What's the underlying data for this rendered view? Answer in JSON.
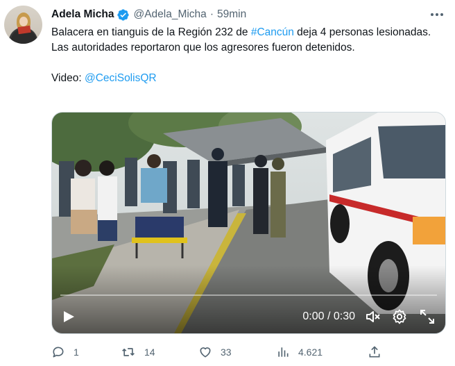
{
  "author": {
    "name": "Adela Micha",
    "handle": "@Adela_Micha",
    "separator": "·",
    "time": "59min"
  },
  "tweet": {
    "text_before_tag": "Balacera en tianguis de la Región 232 de ",
    "hashtag": "#Cancún",
    "text_after_tag": " deja 4 personas lesionadas. Las autoridades reportaron que los agresores fueron detenidos.",
    "video_label": "Video: ",
    "video_credit": "@CeciSolisQR"
  },
  "video": {
    "timecode": "0:00 / 0:30",
    "progress": 0
  },
  "actions": {
    "replies": "1",
    "retweets": "14",
    "likes": "33",
    "views": "4.621"
  },
  "colors": {
    "link": "#1d9bf0",
    "muted": "#536471",
    "verified": "#1d9bf0"
  },
  "icons": [
    "verified-badge-icon",
    "more-icon",
    "play-icon",
    "volume-muted-icon",
    "settings-icon",
    "fullscreen-icon",
    "reply-icon",
    "retweet-icon",
    "like-icon",
    "views-icon",
    "share-icon"
  ]
}
